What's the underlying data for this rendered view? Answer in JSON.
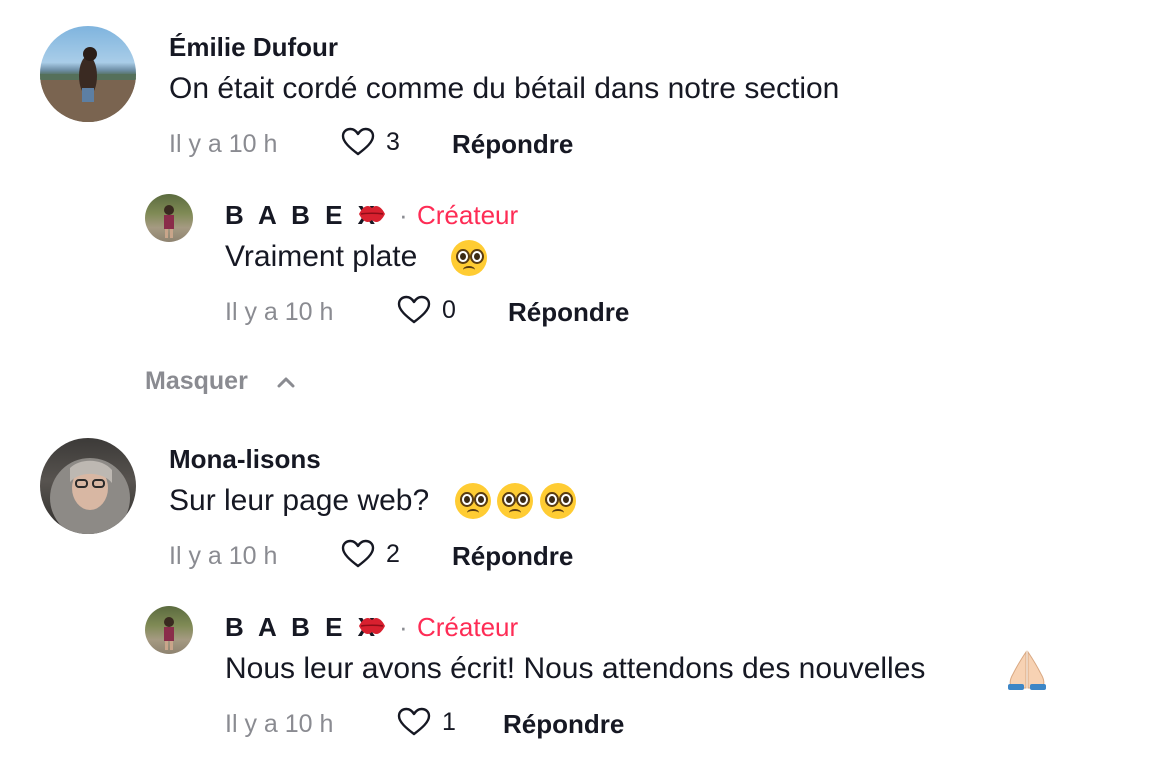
{
  "comments": [
    {
      "author": "Émilie Dufour",
      "text": "On était cordé comme du bétail dans notre section",
      "time": "Il y a 10 h",
      "likes": "3",
      "reply_label": "Répondre",
      "avatar_icon": "user-avatar-photo"
    },
    {
      "author": "B A B E X",
      "author_badge_icon": "kiss-lips-icon",
      "separator": "·",
      "creator_label": "Créateur",
      "text": "Vraiment plate",
      "text_emoji": "pleading-face-emoji",
      "time": "Il y a 10 h",
      "likes": "0",
      "reply_label": "Répondre",
      "avatar_icon": "user-avatar-photo"
    },
    {
      "author": "Mona-lisons",
      "text": "Sur leur page web?",
      "text_emoji": "pleading-face-emoji x3",
      "time": "Il y a 10 h",
      "likes": "2",
      "reply_label": "Répondre",
      "avatar_icon": "user-avatar-photo"
    },
    {
      "author": "B A B E X",
      "author_badge_icon": "kiss-lips-icon",
      "separator": "·",
      "creator_label": "Créateur",
      "text": "Nous leur avons écrit! Nous attendons des nouvelles",
      "text_emoji": "folded-hands-emoji",
      "time": "Il y a 10 h",
      "likes": "1",
      "reply_label": "Répondre",
      "avatar_icon": "user-avatar-photo"
    }
  ],
  "hide_replies_label": "Masquer",
  "colors": {
    "text": "#161823",
    "muted": "#8a8b91",
    "creator": "#fe2c55",
    "emoji_yellow": "#ffcc33"
  }
}
